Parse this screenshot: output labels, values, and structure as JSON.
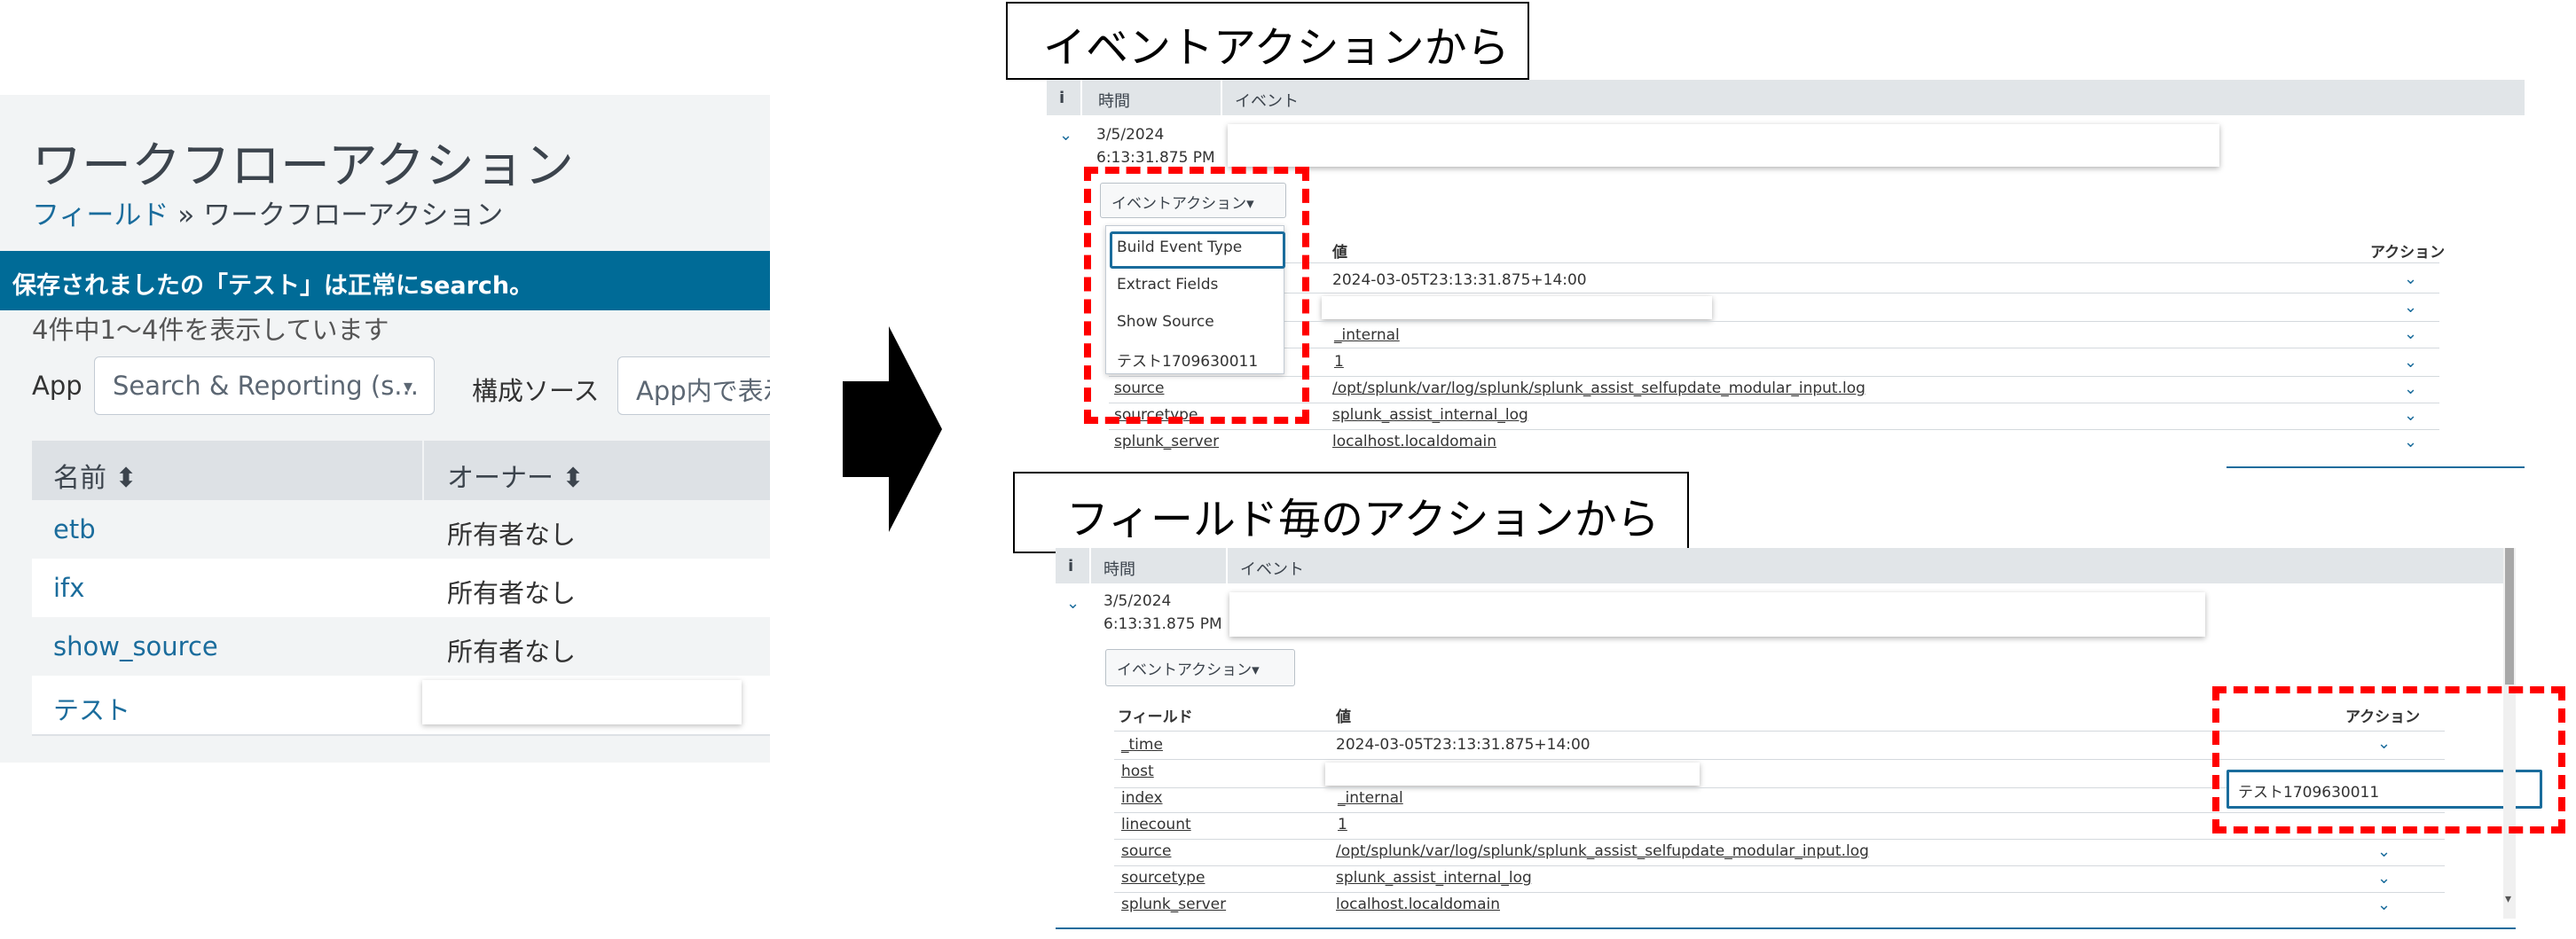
{
  "left": {
    "title": "ワークフローアクション",
    "breadcrumb": {
      "link": "フィールド",
      "sep": " » ",
      "current": "ワークフローアクション"
    },
    "banner": "保存されましたの「テスト」は正常にsearch。",
    "count": "4件中1〜4件を表示しています",
    "app_label": "App",
    "app_select": "Search & Reporting (s...",
    "source_label": "構成ソース",
    "source_select": "App内で表示",
    "columns": {
      "name": "名前 ⬍",
      "owner": "オーナー ⬍"
    },
    "rows": [
      {
        "name": "etb",
        "owner": "所有者なし"
      },
      {
        "name": "ifx",
        "owner": "所有者なし"
      },
      {
        "name": "show_source",
        "owner": "所有者なし"
      },
      {
        "name": "テスト",
        "owner": ""
      }
    ]
  },
  "top": {
    "heading": "イベントアクションから",
    "col_i": "i",
    "col_time": "時間",
    "col_event": "イベント",
    "date": "3/5/2024",
    "time": "6:13:31.875 PM",
    "event_actions_button": "イベントアクション▾",
    "menu": [
      "Build Event Type",
      "Extract Fields",
      "Show Source",
      "テスト1709630011"
    ],
    "value_header": "値",
    "action_header": "アクション",
    "rows": [
      {
        "field": "",
        "value": "2024-03-05T23:13:31.875+14:00"
      },
      {
        "field": "",
        "value": ""
      },
      {
        "field": "",
        "value": "_internal"
      },
      {
        "field": "",
        "value": "1"
      },
      {
        "field": "source",
        "value": "/opt/splunk/var/log/splunk/splunk_assist_selfupdate_modular_input.log"
      },
      {
        "field": "sourcetype",
        "value": "splunk_assist_internal_log"
      },
      {
        "field": "splunk_server",
        "value": "localhost.localdomain"
      }
    ]
  },
  "bottom": {
    "heading": "フィールド毎のアクションから",
    "col_i": "i",
    "col_time": "時間",
    "col_event": "イベント",
    "date": "3/5/2024",
    "time": "6:13:31.875 PM",
    "event_actions_button": "イベントアクション▾",
    "field_header": "フィールド",
    "value_header": "値",
    "action_header": "アクション",
    "popup_item": "テスト1709630011",
    "rows": [
      {
        "field": "_time",
        "value": "2024-03-05T23:13:31.875+14:00"
      },
      {
        "field": "host",
        "value": ""
      },
      {
        "field": "index",
        "value": "_internal"
      },
      {
        "field": "linecount",
        "value": "1"
      },
      {
        "field": "source",
        "value": "/opt/splunk/var/log/splunk/splunk_assist_selfupdate_modular_input.log"
      },
      {
        "field": "sourcetype",
        "value": "splunk_assist_internal_log"
      },
      {
        "field": "splunk_server",
        "value": "localhost.localdomain"
      }
    ]
  },
  "icons": {
    "expand": "chevron-down-icon",
    "sort": "sort-icon",
    "dropdown": "caret-down-icon",
    "arrow": "right-arrow-icon"
  },
  "colors": {
    "banner": "#006b97",
    "link": "#1a6c9c",
    "highlight": "#ff0000"
  }
}
